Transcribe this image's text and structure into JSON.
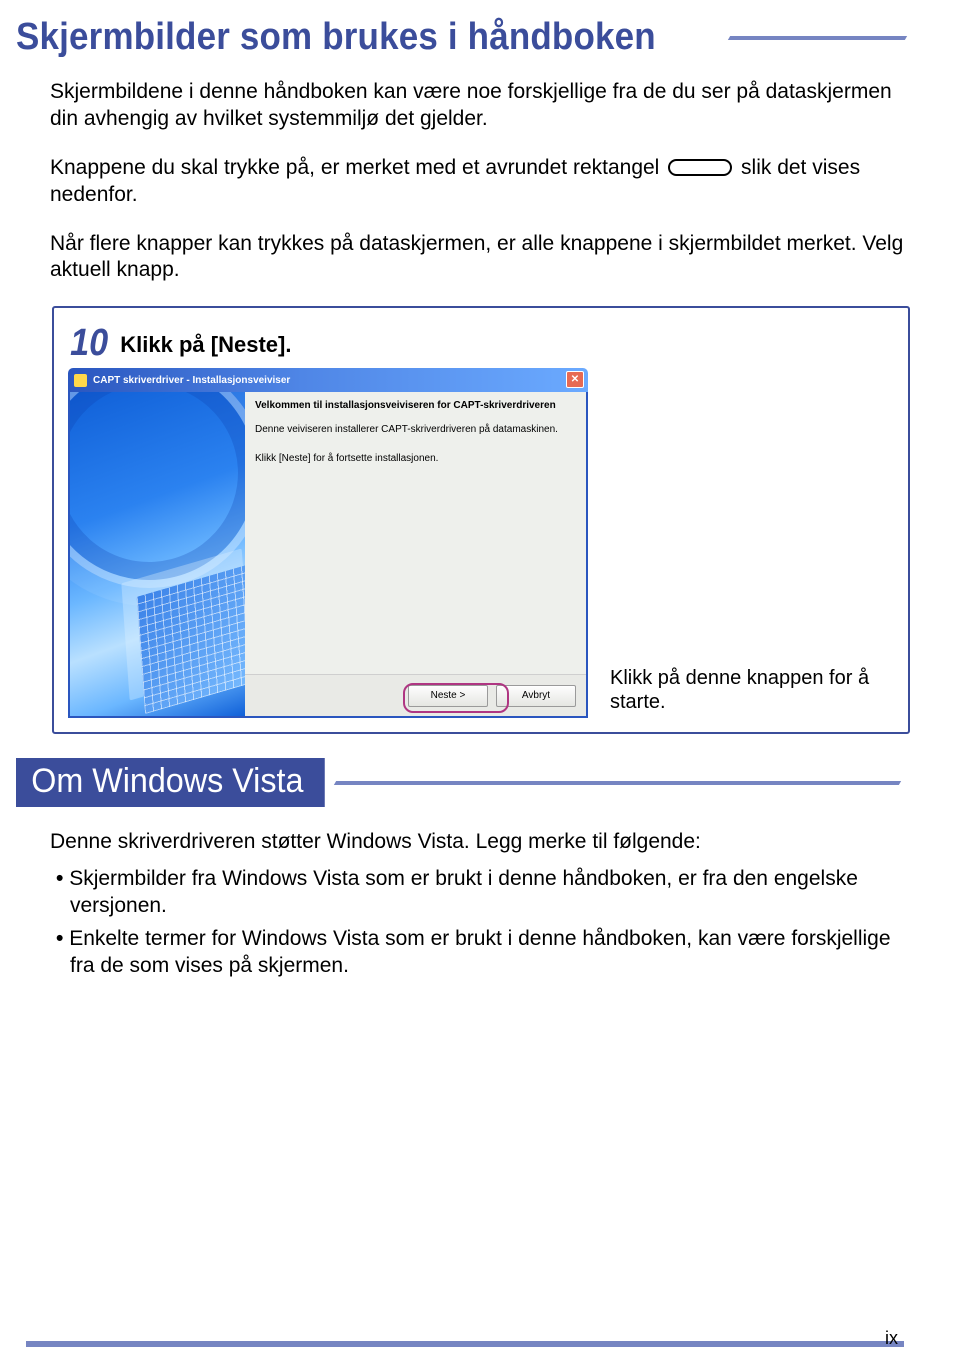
{
  "heading1": "Skjermbilder som brukes i håndboken",
  "intro": {
    "p1": "Skjermbildene i denne håndboken kan være noe forskjellige fra de du ser på dataskjermen din avhengig av hvilket systemmiljø det gjelder.",
    "p2_pre": "Knappene du skal trykke på, er merket med et avrundet rektangel ",
    "p2_post": " slik det vises nedenfor.",
    "p3": "Når flere knapper kan trykkes på dataskjermen, er alle knappene i skjermbildet merket. Velg aktuell knapp."
  },
  "example": {
    "step_num": "10",
    "step_label": "Klikk på [Neste].",
    "titlebar": "CAPT skriverdriver - Installasjonsveiviser",
    "body_p1": "Velkommen til installasjonsveiviseren for CAPT-skriverdriveren",
    "body_p2": "Denne veiviseren installerer CAPT-skriverdriveren på datamaskinen.",
    "body_p3": "Klikk [Neste] for å fortsette installasjonen.",
    "btn_next": "Neste >",
    "btn_cancel": "Avbryt",
    "callout": "Klikk på denne knappen for å starte."
  },
  "section2_title": "Om Windows Vista",
  "vista": {
    "lead": "Denne skriverdriveren støtter Windows Vista. Legg merke til følgende:",
    "b1": "Skjermbilder fra Windows Vista som er brukt i denne håndboken, er fra den engelske versjonen.",
    "b2": "Enkelte termer for Windows Vista som er brukt i denne håndboken, kan være forskjellige fra de som vises på skjermen."
  },
  "page_number": "ix"
}
